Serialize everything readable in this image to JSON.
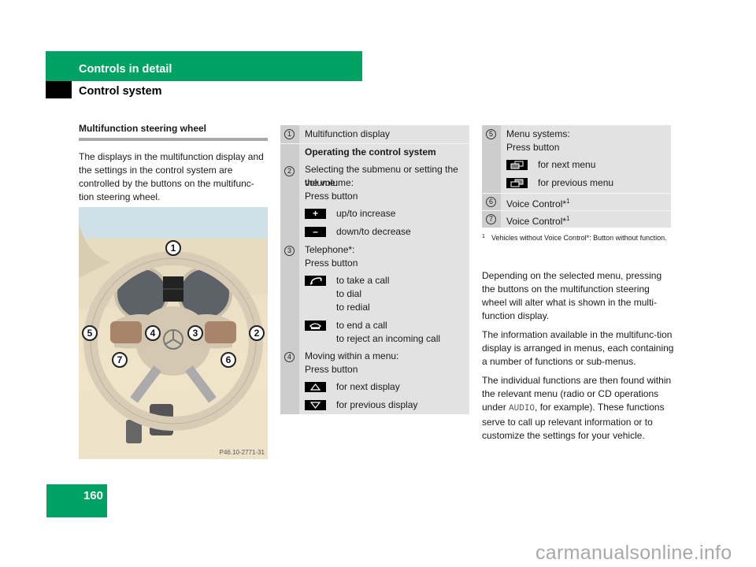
{
  "header": {
    "section": "Controls in detail",
    "subsection": "Control system"
  },
  "left": {
    "title": "Multifunction steering wheel",
    "intro": "The displays in the multifunction display and the settings in the control system are controlled by the buttons on the multifunc-tion steering wheel.",
    "image_code": "P46.10-2771-31",
    "callouts": [
      "1",
      "2",
      "3",
      "4",
      "5",
      "6",
      "7"
    ]
  },
  "table1": {
    "rows": [
      {
        "num": "1",
        "text": "Multifunction display"
      },
      {
        "heading": "Operating the control system"
      },
      {
        "num": "2",
        "text": "Selecting the submenu or setting the volume:",
        "text2": "Press button",
        "keys": [
          {
            "icon": "plus-key-icon",
            "glyph": "+",
            "label": "up/to increase"
          },
          {
            "icon": "minus-key-icon",
            "glyph": "–",
            "label": "down/to decrease"
          }
        ]
      },
      {
        "num": "3",
        "text": "Telephone*:",
        "text2": "Press button",
        "keys": [
          {
            "icon": "phone-pickup-key-icon",
            "label": "to take a call",
            "label2": "to dial",
            "label3": "to redial"
          },
          {
            "icon": "phone-hangup-key-icon",
            "label": "to end a call",
            "label2": "to reject an incoming call"
          }
        ]
      },
      {
        "num": "4",
        "text": "Moving within a menu:",
        "text2": "Press button",
        "keys": [
          {
            "icon": "arrow-up-key-icon",
            "label": "for next display"
          },
          {
            "icon": "arrow-down-key-icon",
            "label": "for previous display"
          }
        ]
      }
    ]
  },
  "table2": {
    "rows": [
      {
        "num": "5",
        "text": "Menu systems:",
        "text2": "Press button",
        "keys": [
          {
            "icon": "next-menu-key-icon",
            "label": "for next menu"
          },
          {
            "icon": "previous-menu-key-icon",
            "label": "for previous menu"
          }
        ]
      },
      {
        "num": "6",
        "text": "Voice Control*",
        "sup": "1"
      },
      {
        "num": "7",
        "text": "Voice Control*",
        "sup": "1"
      }
    ]
  },
  "footnote": {
    "mark": "1",
    "text": "Vehicles without Voice Control*: Button without function."
  },
  "right": {
    "p1": "Depending on the selected menu, pressing the buttons on the multifunction steering wheel will alter what is shown in the multi-function display.",
    "p2": "The information available in the multifunc-tion display is arranged in menus, each containing a number of functions or sub-menus.",
    "p3a": "The individual functions are then found within the relevant menu (radio or CD operations under ",
    "p3_mono": "AUDIO",
    "p3b": ", for example). These functions serve to call up relevant information or to customize the settings for your vehicle."
  },
  "page_number": "160",
  "watermark": "carmanualsonline.info",
  "colors": {
    "brand_green": "#00a263",
    "table_bg": "#e2e2e2",
    "num_col": "#cdcdcd"
  }
}
